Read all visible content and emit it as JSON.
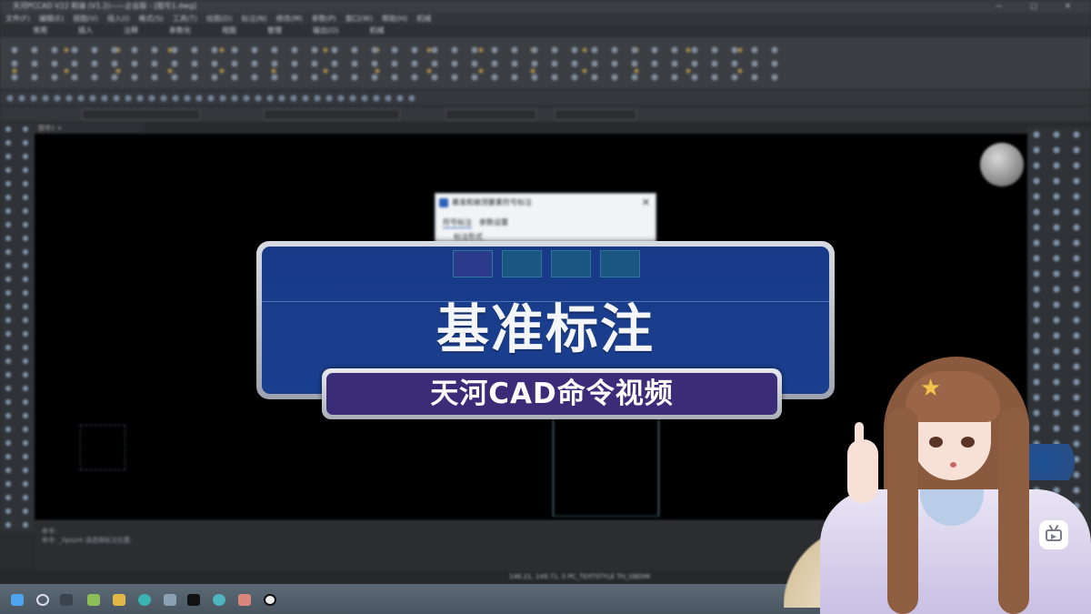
{
  "window": {
    "title": "天河PCCAD V22 和谐 (V1.2)——企业版 - [图号1.dwg]",
    "controls": [
      "—",
      "□",
      "✕"
    ]
  },
  "menubar": [
    "文件(F)",
    "编辑(E)",
    "视图(V)",
    "插入(I)",
    "格式(S)",
    "工具(T)",
    "绘图(D)",
    "标注(N)",
    "修改(M)",
    "参数(P)",
    "窗口(W)",
    "帮助(H)",
    "机械"
  ],
  "ribbon_tabs": [
    "常用",
    "插入",
    "注释",
    "参数化",
    "视图",
    "管理",
    "输出(O)",
    "机械"
  ],
  "doc_tab": "图号1 ×",
  "dialog": {
    "title": "基准和被测要素符号标注",
    "close": "✕",
    "tabs": [
      "符号标注",
      "参数设置"
    ],
    "group": "标注形式"
  },
  "command_area": {
    "lines": [
      "命令:",
      "命令: _hpsym 请选择标注位置:"
    ]
  },
  "status_bar": {
    "coords": "146.21, 149.71, 0  PC_TEXTSTYLE  TH_GBDIM"
  },
  "banner": {
    "title": "基准标注",
    "subtitle": "天河CAD命令视频"
  },
  "colors": {
    "banner_blue": "#0c3488",
    "subtitle_purple": "#3b2c78",
    "canvas": "#000000"
  },
  "icons": {
    "logo": "bilibili-tv-icon",
    "start": "windows-start-icon"
  }
}
